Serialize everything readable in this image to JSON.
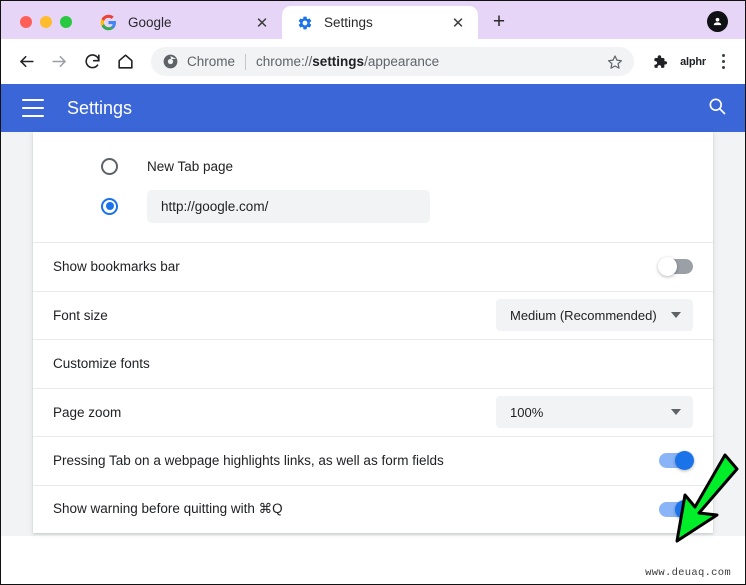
{
  "browser": {
    "traffic_lights": [
      "close",
      "minimize",
      "maximize"
    ],
    "tabs": [
      {
        "title": "Google",
        "favicon": "google-icon",
        "active": false,
        "close_label": "✕"
      },
      {
        "title": "Settings",
        "favicon": "settings-gear-icon",
        "active": true,
        "close_label": "✕"
      }
    ],
    "new_tab_label": "+",
    "profile_icon": "profile-avatar-icon",
    "toolbar": {
      "back_icon": "back-arrow-icon",
      "forward_icon": "forward-arrow-icon",
      "reload_icon": "reload-icon",
      "home_icon": "home-icon",
      "omnibox": {
        "site_icon": "chrome-logo-icon",
        "scheme_label": "Chrome",
        "url_prefix": "chrome://",
        "url_bold": "settings",
        "url_suffix": "/appearance",
        "full_url": "chrome://settings/appearance",
        "bookmark_icon": "star-outline-icon"
      },
      "extension_icon": "puzzle-piece-icon",
      "extension_label": "alphr",
      "menu_icon": "three-dot-menu-icon"
    }
  },
  "settings_header": {
    "menu_icon": "hamburger-menu-icon",
    "title": "Settings",
    "search_icon": "search-icon",
    "background_color": "#3a66d8"
  },
  "appearance": {
    "startup_options": [
      {
        "label": "New Tab page",
        "selected": false,
        "type": "radio"
      },
      {
        "label": "",
        "value": "http://google.com/",
        "selected": true,
        "type": "radio-with-field"
      }
    ],
    "rows": [
      {
        "label": "Show bookmarks bar",
        "control": "toggle",
        "state": "off"
      },
      {
        "label": "Font size",
        "control": "select",
        "value": "Medium (Recommended)"
      },
      {
        "label": "Customize fonts",
        "control": "none"
      },
      {
        "label": "Page zoom",
        "control": "select",
        "value": "100%"
      },
      {
        "label": "Pressing Tab on a webpage highlights links, as well as form fields",
        "control": "toggle",
        "state": "on"
      },
      {
        "label": "Show warning before quitting with ⌘Q",
        "control": "toggle",
        "state": "on"
      }
    ]
  },
  "annotation": {
    "arrow_color": "#00ee2a",
    "arrow_target": "page-zoom-select"
  },
  "watermark": "www.deuaq.com",
  "colors": {
    "tabstrip": "#e7d5f7",
    "settings_blue": "#3a66d8",
    "toggle_on": "#1a73e8",
    "toggle_off": "#9aa0a6",
    "field_bg": "#f1f3f4",
    "content_bg": "#f1f3f4"
  }
}
